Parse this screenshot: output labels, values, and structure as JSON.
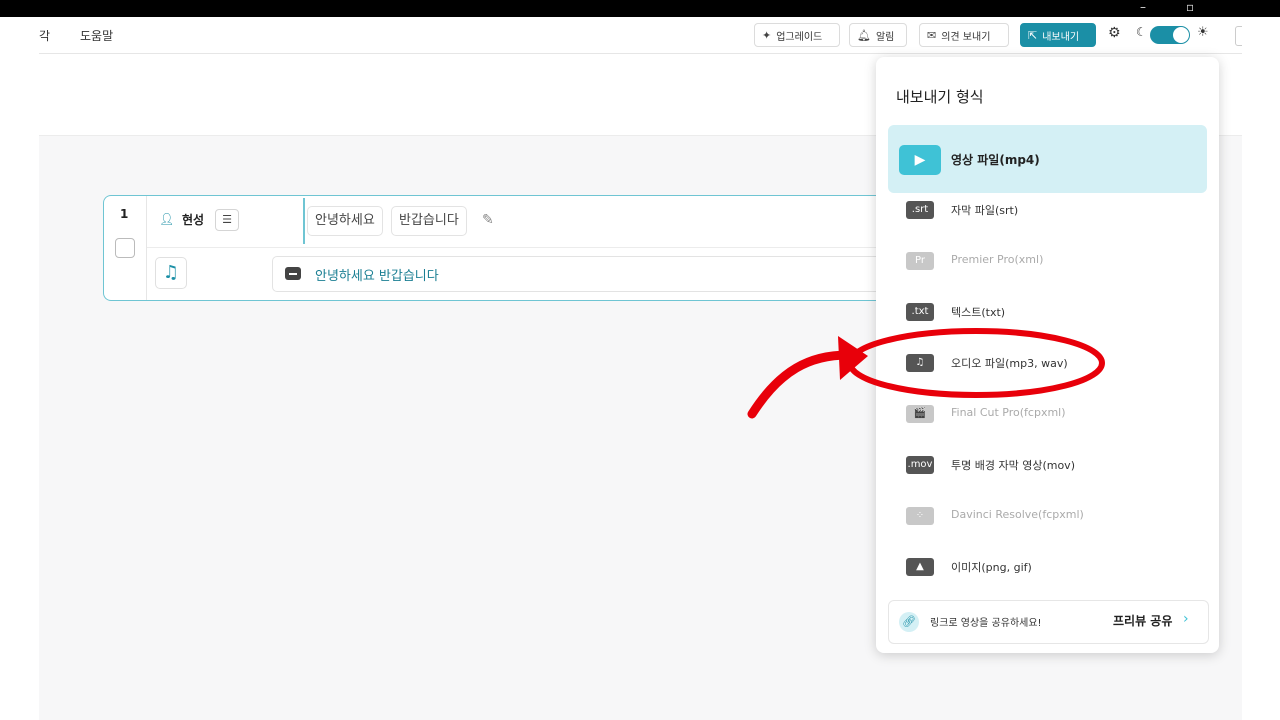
{
  "window": {
    "minimize_glyph": "–",
    "restore_glyph": "▫"
  },
  "menubar": {
    "left_partial": "각",
    "help": "도움말",
    "upgrade_label": "업그레이드",
    "notify_label": "알림",
    "feedback_label": "의견 보내기",
    "export_label": "내보내기"
  },
  "clip": {
    "number": "1",
    "speaker": "현성",
    "words": [
      "안녕하세요",
      "반갑습니다"
    ],
    "subtitle": "안녕하세요 반갑습니다"
  },
  "export_menu": {
    "title": "내보내기 형식",
    "items": [
      {
        "icon": "▶",
        "label": "영상 파일(mp4)",
        "state": "active"
      },
      {
        "icon": ".srt",
        "label": "자막 파일(srt)",
        "state": "enabled"
      },
      {
        "icon": "Pr",
        "label": "Premier Pro(xml)",
        "state": "disabled"
      },
      {
        "icon": ".txt",
        "label": "텍스트(txt)",
        "state": "enabled"
      },
      {
        "icon": "♫",
        "label": "오디오 파일(mp3, wav)",
        "state": "enabled",
        "highlighted": true
      },
      {
        "icon": "🎬",
        "label": "Final Cut Pro(fcpxml)",
        "state": "disabled"
      },
      {
        "icon": ".mov",
        "label": "투명 배경 자막 영상(mov)",
        "state": "enabled"
      },
      {
        "icon": "⁘",
        "label": "Davinci Resolve(fcpxml)",
        "state": "disabled"
      },
      {
        "icon": "▲",
        "label": "이미지(png, gif)",
        "state": "enabled"
      }
    ],
    "share_text": "링크로 영상을 공유하세요!",
    "share_button": "프리뷰 공유"
  },
  "colors": {
    "accent": "#1b8fa6",
    "annotation": "#e8000a",
    "active_bg": "#d4f0f5"
  },
  "icons": {
    "upgrade": "sparkle-icon",
    "notify": "bell-icon",
    "feedback": "mail-icon",
    "export": "export-icon",
    "settings": "gear-icon",
    "dark_mode": "moon-icon",
    "light_mode": "sun-icon"
  }
}
